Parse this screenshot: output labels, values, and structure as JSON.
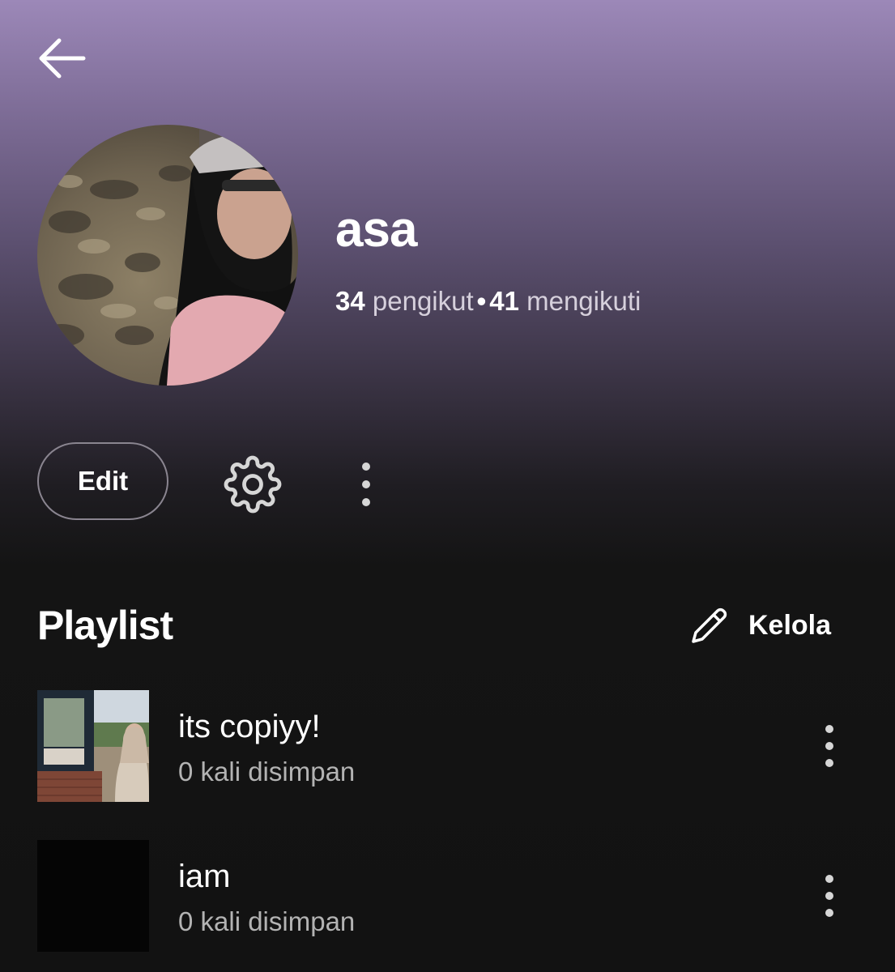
{
  "header": {
    "back_icon": "arrow-left-icon"
  },
  "profile": {
    "avatar_icon": "profile-photo",
    "name": "asa",
    "followers_count": "34",
    "followers_label": "pengikut",
    "separator": "•",
    "following_count": "41",
    "following_label": "mengikuti"
  },
  "actions": {
    "edit_label": "Edit",
    "settings_icon": "gear-icon",
    "more_icon": "more-vertical-icon"
  },
  "playlist_section": {
    "heading": "Playlist",
    "manage_icon": "pencil-icon",
    "manage_label": "Kelola",
    "items": [
      {
        "title": "its copiyy!",
        "subtitle": "0 kali disimpan",
        "thumbnail": "photo-thumbnail"
      },
      {
        "title": "iam",
        "subtitle": "0 kali disimpan",
        "thumbnail": "black-thumbnail"
      }
    ]
  },
  "colors": {
    "gradient_top": "#9c88b8",
    "background": "#121212",
    "text_primary": "#ffffff",
    "text_secondary": "#b3b3b3",
    "button_border": "#8a8590"
  }
}
